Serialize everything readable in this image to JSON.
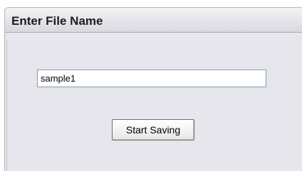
{
  "dialog": {
    "title": "Enter File Name",
    "filename_value": "sample1",
    "start_button_label": "Start Saving"
  }
}
